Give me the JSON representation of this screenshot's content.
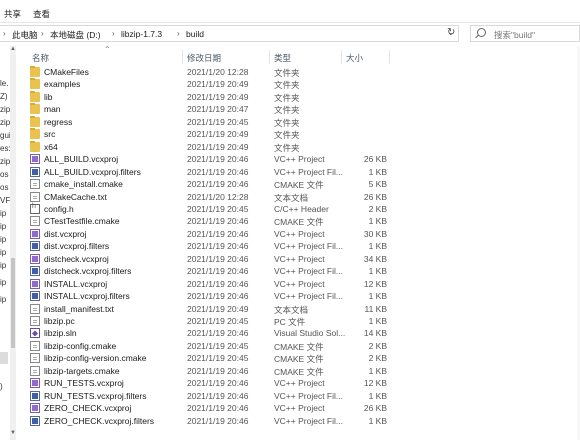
{
  "ribbon": {
    "share_label": "共享",
    "view_label": "查看"
  },
  "address": {
    "crumbs": [
      "此电脑",
      "本地磁盘 (D:)",
      "libzip-1.7.3",
      "build"
    ],
    "separator": "›",
    "dropdown_icon": "chevron-down-icon",
    "refresh_icon": "refresh-icon"
  },
  "search": {
    "placeholder": "搜索\"build\""
  },
  "nav": {
    "labels": [
      "le.",
      "Z)",
      "zip",
      "zip",
      "gui",
      "es:",
      "zip",
      "os",
      "os",
      "VF",
      "ip",
      "ip",
      "ip",
      "ip",
      "ip",
      "ip",
      "ip",
      ")"
    ]
  },
  "columns": {
    "name": "名称",
    "date": "修改日期",
    "type": "类型",
    "size": "大小"
  },
  "files": [
    {
      "name": "CMakeFiles",
      "date": "2021/1/20 12:28",
      "type": "文件夹",
      "size": "",
      "icon": "folder"
    },
    {
      "name": "examples",
      "date": "2021/1/19 20:49",
      "type": "文件夹",
      "size": "",
      "icon": "folder"
    },
    {
      "name": "lib",
      "date": "2021/1/19 20:49",
      "type": "文件夹",
      "size": "",
      "icon": "folder"
    },
    {
      "name": "man",
      "date": "2021/1/19 20:47",
      "type": "文件夹",
      "size": "",
      "icon": "folder"
    },
    {
      "name": "regress",
      "date": "2021/1/19 20:45",
      "type": "文件夹",
      "size": "",
      "icon": "folder"
    },
    {
      "name": "src",
      "date": "2021/1/19 20:49",
      "type": "文件夹",
      "size": "",
      "icon": "folder"
    },
    {
      "name": "x64",
      "date": "2021/1/19 20:49",
      "type": "文件夹",
      "size": "",
      "icon": "folder"
    },
    {
      "name": "ALL_BUILD.vcxproj",
      "date": "2021/1/19 20:46",
      "type": "VC++ Project",
      "size": "26 KB",
      "icon": "vc"
    },
    {
      "name": "ALL_BUILD.vcxproj.filters",
      "date": "2021/1/19 20:46",
      "type": "VC++ Project Fil...",
      "size": "1 KB",
      "icon": "vcf"
    },
    {
      "name": "cmake_install.cmake",
      "date": "2021/1/19 20:46",
      "type": "CMAKE 文件",
      "size": "5 KB",
      "icon": "file"
    },
    {
      "name": "CMakeCache.txt",
      "date": "2021/1/20 12:28",
      "type": "文本文档",
      "size": "26 KB",
      "icon": "file"
    },
    {
      "name": "config.h",
      "date": "2021/1/19 20:45",
      "type": "C/C++ Header",
      "size": "2 KB",
      "icon": "hdr"
    },
    {
      "name": "CTestTestfile.cmake",
      "date": "2021/1/19 20:46",
      "type": "CMAKE 文件",
      "size": "1 KB",
      "icon": "file"
    },
    {
      "name": "dist.vcxproj",
      "date": "2021/1/19 20:46",
      "type": "VC++ Project",
      "size": "30 KB",
      "icon": "vc"
    },
    {
      "name": "dist.vcxproj.filters",
      "date": "2021/1/19 20:46",
      "type": "VC++ Project Fil...",
      "size": "1 KB",
      "icon": "vcf"
    },
    {
      "name": "distcheck.vcxproj",
      "date": "2021/1/19 20:46",
      "type": "VC++ Project",
      "size": "34 KB",
      "icon": "vc"
    },
    {
      "name": "distcheck.vcxproj.filters",
      "date": "2021/1/19 20:46",
      "type": "VC++ Project Fil...",
      "size": "1 KB",
      "icon": "vcf"
    },
    {
      "name": "INSTALL.vcxproj",
      "date": "2021/1/19 20:46",
      "type": "VC++ Project",
      "size": "12 KB",
      "icon": "vc"
    },
    {
      "name": "INSTALL.vcxproj.filters",
      "date": "2021/1/19 20:46",
      "type": "VC++ Project Fil...",
      "size": "1 KB",
      "icon": "vcf"
    },
    {
      "name": "install_manifest.txt",
      "date": "2021/1/19 20:49",
      "type": "文本文档",
      "size": "11 KB",
      "icon": "file"
    },
    {
      "name": "libzip.pc",
      "date": "2021/1/19 20:45",
      "type": "PC 文件",
      "size": "1 KB",
      "icon": "file"
    },
    {
      "name": "libzip.sln",
      "date": "2021/1/19 20:46",
      "type": "Visual Studio Sol...",
      "size": "14 KB",
      "icon": "sln"
    },
    {
      "name": "libzip-config.cmake",
      "date": "2021/1/19 20:45",
      "type": "CMAKE 文件",
      "size": "2 KB",
      "icon": "file"
    },
    {
      "name": "libzip-config-version.cmake",
      "date": "2021/1/19 20:45",
      "type": "CMAKE 文件",
      "size": "2 KB",
      "icon": "file"
    },
    {
      "name": "libzip-targets.cmake",
      "date": "2021/1/19 20:46",
      "type": "CMAKE 文件",
      "size": "1 KB",
      "icon": "file"
    },
    {
      "name": "RUN_TESTS.vcxproj",
      "date": "2021/1/19 20:46",
      "type": "VC++ Project",
      "size": "12 KB",
      "icon": "vc"
    },
    {
      "name": "RUN_TESTS.vcxproj.filters",
      "date": "2021/1/19 20:46",
      "type": "VC++ Project Fil...",
      "size": "1 KB",
      "icon": "vcf"
    },
    {
      "name": "ZERO_CHECK.vcxproj",
      "date": "2021/1/19 20:46",
      "type": "VC++ Project",
      "size": "26 KB",
      "icon": "vc"
    },
    {
      "name": "ZERO_CHECK.vcxproj.filters",
      "date": "2021/1/19 20:46",
      "type": "VC++ Project Fil...",
      "size": "1 KB",
      "icon": "vcf"
    }
  ]
}
